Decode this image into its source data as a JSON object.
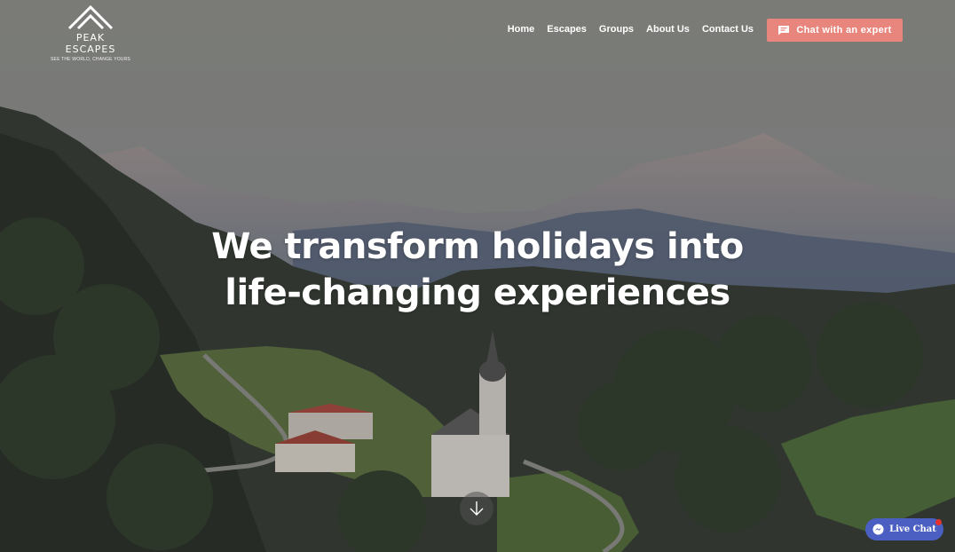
{
  "brand": {
    "name": "PEAK ESCAPES",
    "tagline": "SEE THE WORLD, CHANGE YOURS"
  },
  "nav": {
    "items": [
      {
        "label": "Home"
      },
      {
        "label": "Escapes"
      },
      {
        "label": "Groups"
      },
      {
        "label": "About Us"
      },
      {
        "label": "Contact Us"
      }
    ]
  },
  "cta": {
    "label": "Chat with an expert",
    "icon": "chat-bubble-icon",
    "color": "#e8857c"
  },
  "hero": {
    "headline_line1": "We transform holidays into",
    "headline_line2": "life-changing experiences",
    "scroll_icon": "arrow-down-icon"
  },
  "live_chat": {
    "label": "Live Chat",
    "icon": "messenger-icon",
    "color": "#4a5fc1"
  }
}
